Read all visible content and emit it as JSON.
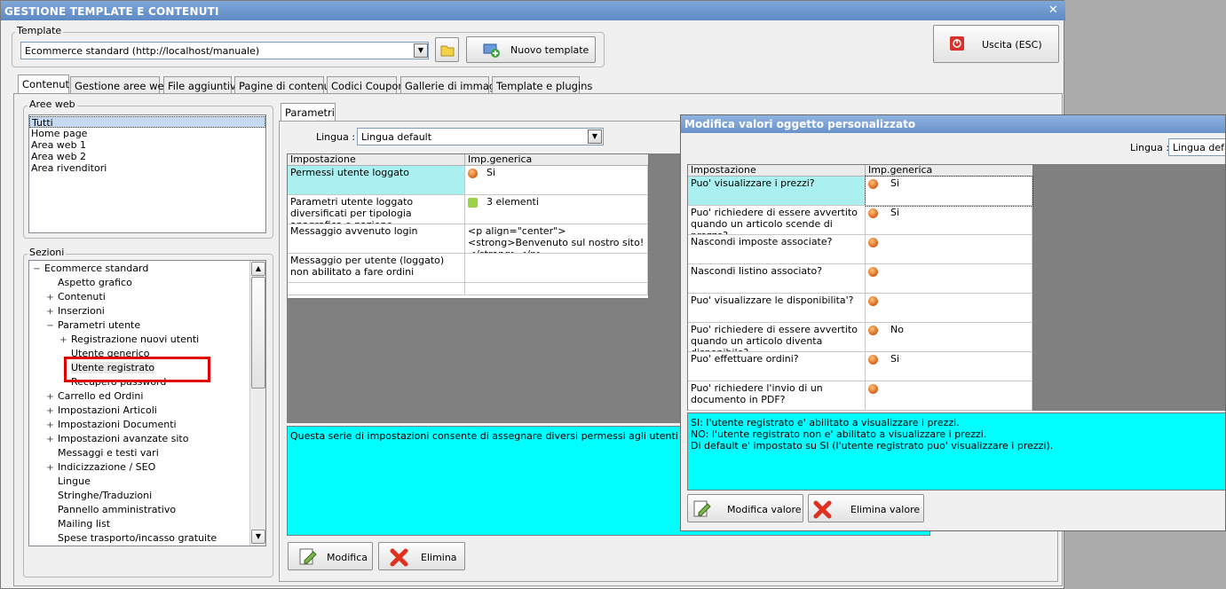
{
  "window": {
    "title": "GESTIONE TEMPLATE E CONTENUTI",
    "close": "✕"
  },
  "template": {
    "group_label": "Template",
    "value": "Ecommerce standard (http://localhost/manuale)",
    "new_label": "Nuovo template",
    "exit_label": "Uscita (ESC)"
  },
  "tabs": [
    "Contenuti",
    "Gestione aree web",
    "File aggiuntivi",
    "Pagine di contenuti",
    "Codici Coupon",
    "Gallerie di immagini",
    "Template e plugins"
  ],
  "aree": {
    "label": "Aree web",
    "items": [
      "Tutti",
      "Home page",
      "Area web 1",
      "Area web 2",
      "Area rivenditori"
    ]
  },
  "sezioni": {
    "label": "Sezioni",
    "items": [
      {
        "text": "Ecommerce standard",
        "exp": "−"
      },
      {
        "text": "Aspetto grafico",
        "exp": ""
      },
      {
        "text": "Contenuti",
        "exp": "+"
      },
      {
        "text": "Inserzioni",
        "exp": "+"
      },
      {
        "text": "Parametri utente",
        "exp": "−"
      },
      {
        "text": "Registrazione nuovi utenti",
        "exp": "+"
      },
      {
        "text": "Utente generico",
        "exp": ""
      },
      {
        "text": "Utente registrato",
        "exp": ""
      },
      {
        "text": "Recupero password",
        "exp": ""
      },
      {
        "text": "Carrello ed Ordini",
        "exp": "+"
      },
      {
        "text": "Impostazioni Articoli",
        "exp": "+"
      },
      {
        "text": "Impostazioni Documenti",
        "exp": "+"
      },
      {
        "text": "Impostazioni avanzate sito",
        "exp": "+"
      },
      {
        "text": "Messaggi e testi vari",
        "exp": ""
      },
      {
        "text": "Indicizzazione / SEO",
        "exp": "+"
      },
      {
        "text": "Lingue",
        "exp": ""
      },
      {
        "text": "Stringhe/Traduzioni",
        "exp": ""
      },
      {
        "text": "Pannello amministrativo",
        "exp": ""
      },
      {
        "text": "Mailing list",
        "exp": ""
      },
      {
        "text": "Spese trasporto/incasso gratuite",
        "exp": ""
      }
    ]
  },
  "parametri": {
    "tab": "Parametri",
    "lingua_label": "Lingua :",
    "lingua_value": "Lingua default",
    "headers": [
      "Impostazione",
      "Imp.generica"
    ],
    "rows": [
      {
        "name": "Permessi utente loggato",
        "value": "Si"
      },
      {
        "name": "Parametri utente loggato diversificati per tipologia anagrafica e nazione",
        "value": "3 elementi"
      },
      {
        "name": "Messaggio avvenuto login",
        "value": "<p align=\"center\"><strong>Benvenuto sul nostro sito!</strong></p>"
      },
      {
        "name": "Messaggio per utente (loggato) non abilitato a fare ordini",
        "value": ""
      },
      {
        "name": "",
        "value": ""
      }
    ],
    "description": "Questa serie di impostazioni consente di assegnare diversi permessi agli utenti (dopo l'avvenuto",
    "modify": "Modifica",
    "delete": "Elimina"
  },
  "dialog": {
    "title": "Modifica valori oggetto personalizzato",
    "lingua_label": "Lingua :",
    "lingua_value": "Lingua default",
    "headers": [
      "Impostazione",
      "Imp.generica"
    ],
    "rows": [
      {
        "name": "Puo' visualizzare i prezzi?",
        "value": "Si"
      },
      {
        "name": "Puo' richiedere di essere avvertito quando un articolo scende di prezzo?",
        "value": "Si"
      },
      {
        "name": "Nascondi imposte associate?",
        "value": ""
      },
      {
        "name": "Nascondi listino associato?",
        "value": ""
      },
      {
        "name": "Puo' visualizzare le disponibilita'?",
        "value": ""
      },
      {
        "name": "Puo' richiedere di essere avvertito quando un articolo diventa disponibile?",
        "value": "No"
      },
      {
        "name": "Puo' effettuare ordini?",
        "value": "Si"
      },
      {
        "name": "Puo' richiedere l'invio di un documento in PDF?",
        "value": ""
      }
    ],
    "info": [
      "SI: l'utente registrato e' abilitato a visualizzare i prezzi.",
      "NO: l'utente registrato non e' abilitato a visualizzare i prezzi.",
      "Di default e' impostato su SI (l'utente registrato puo' visualizzare i prezzi)."
    ],
    "modify": "Modifica valore",
    "delete": "Elimina valore"
  },
  "colors": {
    "highlight": "#aaf0f0",
    "info_bg": "#00ffff",
    "selection_box": "#e00000"
  }
}
